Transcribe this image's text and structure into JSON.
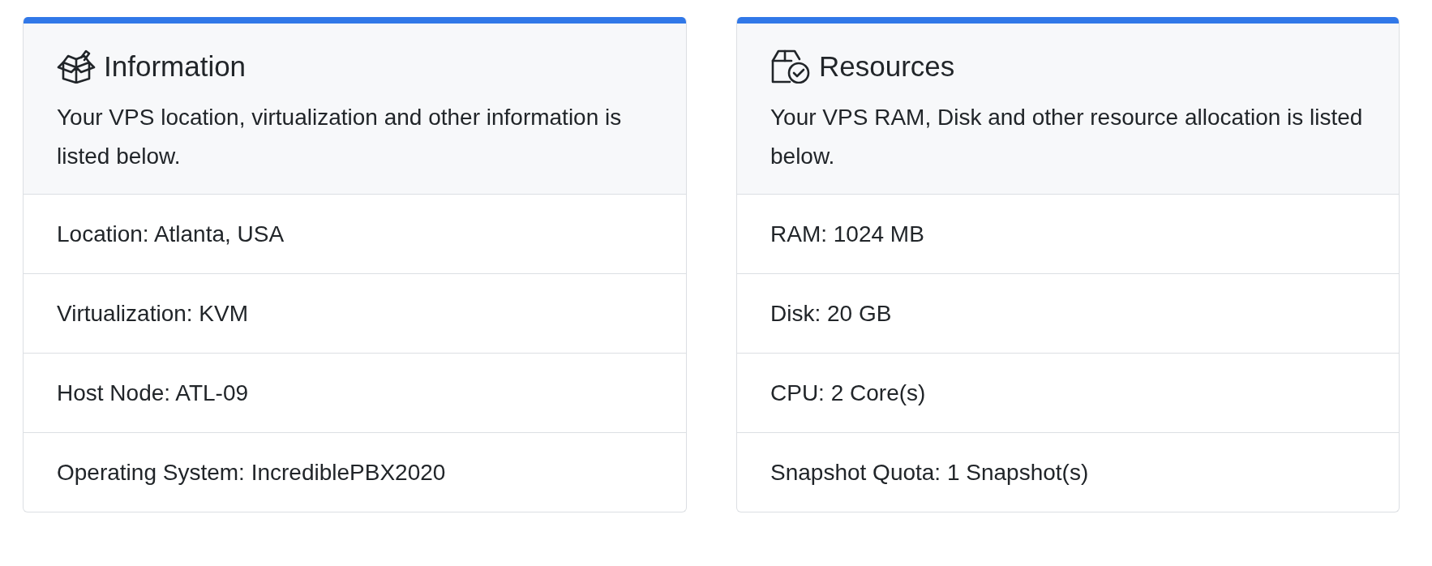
{
  "cards": [
    {
      "kind": "information",
      "title": "Information",
      "description": "Your VPS location, virtualization and other information is listed below.",
      "items": [
        "Location: Atlanta, USA",
        "Virtualization: KVM",
        "Host Node: ATL-09",
        "Operating System: IncrediblePBX2020"
      ]
    },
    {
      "kind": "resources",
      "title": "Resources",
      "description": "Your VPS RAM, Disk and other resource allocation is listed below.",
      "items": [
        "RAM: 1024 MB",
        "Disk: 20 GB",
        "CPU: 2 Core(s)",
        "Snapshot Quota: 1 Snapshot(s)"
      ]
    }
  ]
}
